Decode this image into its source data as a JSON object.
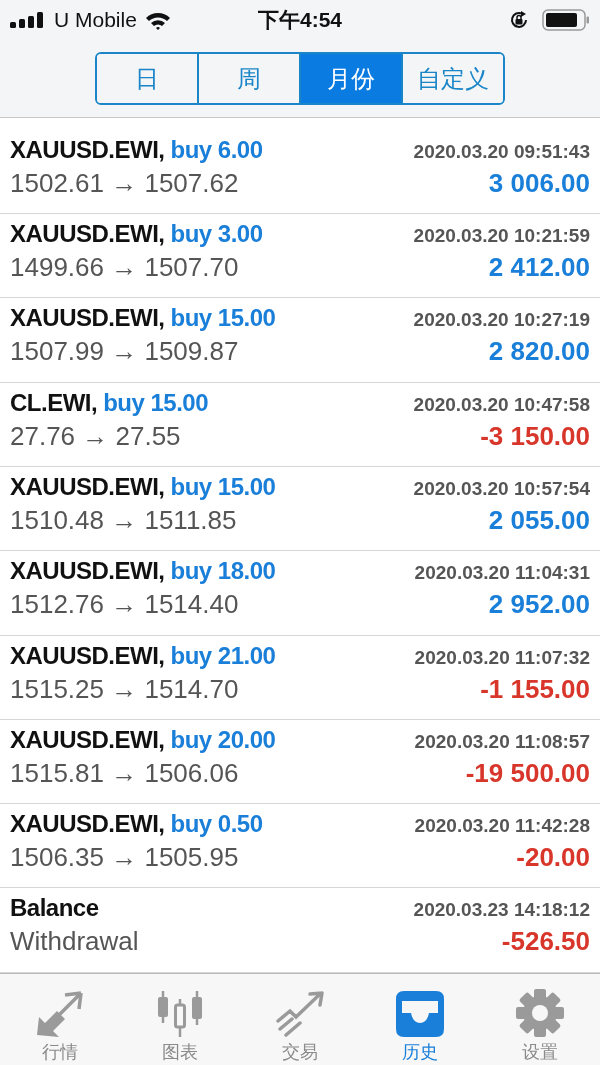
{
  "status_bar": {
    "carrier": "U Mobile",
    "time": "下午4:54"
  },
  "period_tabs": [
    {
      "label": "日",
      "selected": false
    },
    {
      "label": "周",
      "selected": false
    },
    {
      "label": "月份",
      "selected": true
    },
    {
      "label": "自定义",
      "selected": false
    }
  ],
  "deals": [
    {
      "kind": "trade",
      "symbol": "XAUUSD.EWI,",
      "side": "buy 6.00",
      "time": "2020.03.20 09:51:43",
      "prices": "1502.61 → 1507.62",
      "profit": "3 006.00",
      "color": "#1a7fd9"
    },
    {
      "kind": "trade",
      "symbol": "XAUUSD.EWI,",
      "side": "buy 3.00",
      "time": "2020.03.20 10:21:59",
      "prices": "1499.66 → 1507.70",
      "profit": "2 412.00",
      "color": "#1a7fd9"
    },
    {
      "kind": "trade",
      "symbol": "XAUUSD.EWI,",
      "side": "buy 15.00",
      "time": "2020.03.20 10:27:19",
      "prices": "1507.99 → 1509.87",
      "profit": "2 820.00",
      "color": "#1a7fd9"
    },
    {
      "kind": "trade",
      "symbol": "CL.EWI,",
      "side": "buy 15.00",
      "time": "2020.03.20 10:47:58",
      "prices": "27.76 → 27.55",
      "profit": "-3 150.00",
      "color": "#d8362a"
    },
    {
      "kind": "trade",
      "symbol": "XAUUSD.EWI,",
      "side": "buy 15.00",
      "time": "2020.03.20 10:57:54",
      "prices": "1510.48 → 1511.85",
      "profit": "2 055.00",
      "color": "#1a7fd9"
    },
    {
      "kind": "trade",
      "symbol": "XAUUSD.EWI,",
      "side": "buy 18.00",
      "time": "2020.03.20 11:04:31",
      "prices": "1512.76 → 1514.40",
      "profit": "2 952.00",
      "color": "#1a7fd9"
    },
    {
      "kind": "trade",
      "symbol": "XAUUSD.EWI,",
      "side": "buy 21.00",
      "time": "2020.03.20 11:07:32",
      "prices": "1515.25 → 1514.70",
      "profit": "-1 155.00",
      "color": "#d8362a"
    },
    {
      "kind": "trade",
      "symbol": "XAUUSD.EWI,",
      "side": "buy 20.00",
      "time": "2020.03.20 11:08:57",
      "prices": "1515.81 → 1506.06",
      "profit": "-19 500.00",
      "color": "#d8362a"
    },
    {
      "kind": "trade",
      "symbol": "XAUUSD.EWI,",
      "side": "buy 0.50",
      "time": "2020.03.20 11:42:28",
      "prices": "1506.35 → 1505.95",
      "profit": "-20.00",
      "color": "#d8362a"
    },
    {
      "kind": "balance",
      "symbol": "Balance",
      "time": "2020.03.23 14:18:12",
      "prices": "Withdrawal",
      "profit": "-526.50",
      "color": "#d8362a"
    }
  ],
  "bottom_nav": [
    {
      "label": "行情",
      "kind": "quotes",
      "selected": false
    },
    {
      "label": "图表",
      "kind": "chart",
      "selected": false
    },
    {
      "label": "交易",
      "kind": "trade",
      "selected": false
    },
    {
      "label": "历史",
      "kind": "history",
      "selected": true
    },
    {
      "label": "设置",
      "kind": "settings",
      "selected": false
    }
  ]
}
